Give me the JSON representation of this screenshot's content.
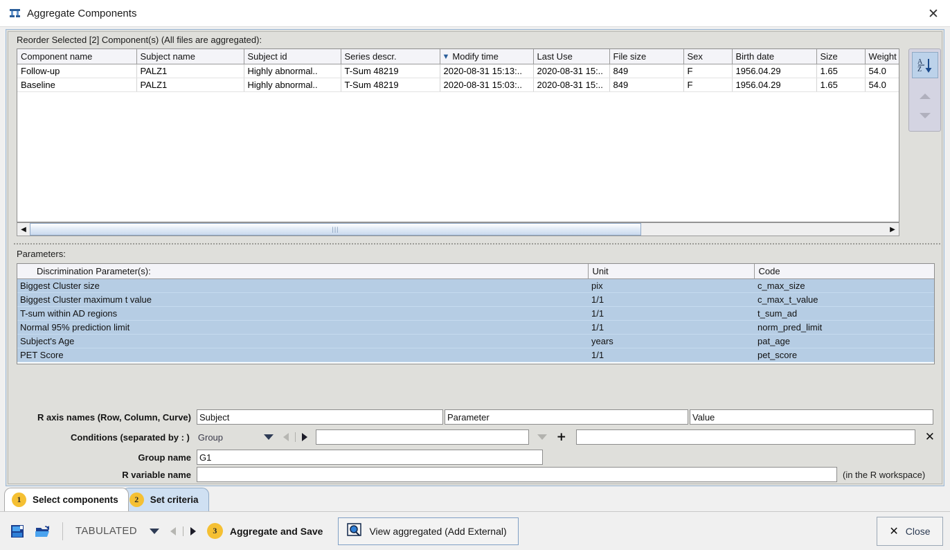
{
  "window": {
    "title": "Aggregate Components",
    "icon": "aggregate-icon",
    "close_label": "✕"
  },
  "components_section": {
    "label": "Reorder Selected [2] Component(s) (All files are aggregated):",
    "columns": [
      "Component name",
      "Subject name",
      "Subject id",
      "Series descr.",
      "Modify time",
      "Last Use",
      "File size",
      "Sex",
      "Birth date",
      "Size",
      "Weight"
    ],
    "sorted_column": "Modify time",
    "rows": [
      {
        "component_name": "Follow-up",
        "subject_name": "PALZ1",
        "subject_id": "Highly abnormal..",
        "series_descr": "T-Sum 48219",
        "modify_time": "2020-08-31 15:13:..",
        "last_use": "2020-08-31 15:..",
        "file_size": "849",
        "sex": "F",
        "birth_date": "1956.04.29",
        "size": "1.65",
        "weight": "54.0"
      },
      {
        "component_name": "Baseline",
        "subject_name": "PALZ1",
        "subject_id": "Highly abnormal..",
        "series_descr": "T-Sum 48219",
        "modify_time": "2020-08-31 15:03:..",
        "last_use": "2020-08-31 15:..",
        "file_size": "849",
        "sex": "F",
        "birth_date": "1956.04.29",
        "size": "1.65",
        "weight": "54.0"
      }
    ],
    "sort_button": "sort-az-button",
    "move_up": "move-up-arrow",
    "move_down": "move-down-arrow",
    "scroll_left": "◀",
    "scroll_right": "▶",
    "scroll_grip": "|||"
  },
  "parameters_section": {
    "label": "Parameters:",
    "columns": [
      "Discrimination Parameter(s):",
      "Unit",
      "Code"
    ],
    "rows": [
      {
        "name": "Biggest Cluster size",
        "unit": "pix",
        "code": "c_max_size"
      },
      {
        "name": "Biggest Cluster maximum t value",
        "unit": "1/1",
        "code": "c_max_t_value"
      },
      {
        "name": "T-sum within AD regions",
        "unit": "1/1",
        "code": "t_sum_ad"
      },
      {
        "name": "Normal 95% prediction limit",
        "unit": "1/1",
        "code": "norm_pred_limit"
      },
      {
        "name": "Subject's Age",
        "unit": "years",
        "code": "pat_age"
      },
      {
        "name": "PET Score",
        "unit": "1/1",
        "code": "pet_score"
      }
    ]
  },
  "form": {
    "axis_names_label": "R axis names (Row, Column, Curve)",
    "axis_row_value": "Subject",
    "axis_col_value": "Parameter",
    "axis_curve_value": "Value",
    "conditions_label": "Conditions (separated by : )",
    "conditions_combo_value": "Group",
    "conditions_field_value": "",
    "conditions_value_field": "",
    "add_condition": "+",
    "remove_condition": "✕",
    "group_name_label": "Group name",
    "group_name_value": "G1",
    "r_variable_label": "R variable name",
    "r_variable_value": "",
    "r_workspace_hint": "(in the R workspace)"
  },
  "tabs": [
    {
      "num": "1",
      "label": "Select components",
      "state": "active"
    },
    {
      "num": "2",
      "label": "Set criteria",
      "state": "inactive"
    }
  ],
  "toolbar": {
    "save_icon": "save-floppy-icon",
    "open_icon": "open-folder-icon",
    "format_label": "TABULATED",
    "aggregate_num": "3",
    "aggregate_label": "Aggregate and Save",
    "view_icon": "view-aggregated-icon",
    "view_label": "View aggregated (Add External)",
    "close_icon": "✕",
    "close_label": "Close"
  },
  "colors": {
    "accent_blue": "#9ab8d8",
    "row_selected": "#b6cde4",
    "badge_yellow": "#f5c033",
    "window_bg": "#dfdfdb"
  }
}
